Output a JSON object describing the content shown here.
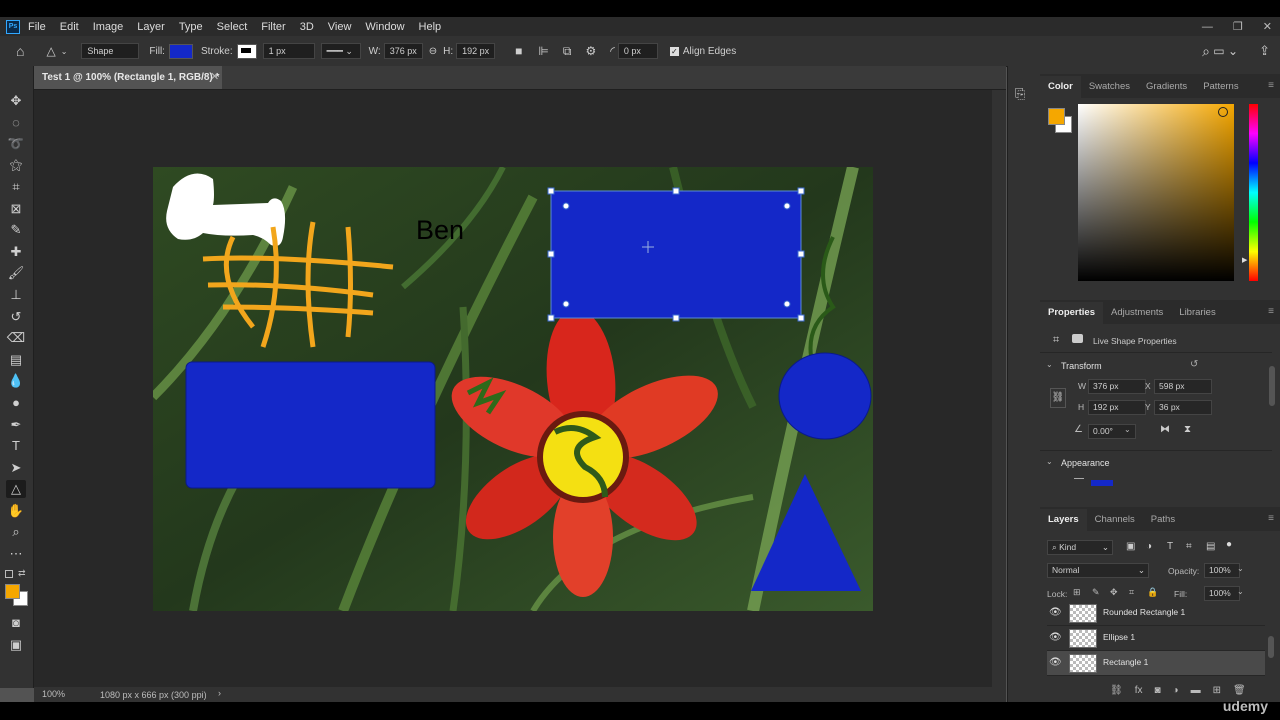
{
  "menu": {
    "items": [
      "File",
      "Edit",
      "Image",
      "Layer",
      "Type",
      "Select",
      "Filter",
      "3D",
      "View",
      "Window",
      "Help"
    ]
  },
  "options_bar": {
    "mode": "Shape",
    "fill_label": "Fill:",
    "stroke_label": "Stroke:",
    "stroke_width": "1 px",
    "w_label": "W:",
    "w_value": "376 px",
    "h_label": "H:",
    "h_value": "192 px",
    "radius_value": "0 px",
    "align_edges_label": "Align Edges",
    "align_edges_checked": true,
    "fill_color": "#1428c8"
  },
  "document": {
    "tab_title": "Test 1 @ 100% (Rectangle 1, RGB/8) *",
    "canvas_text": "Ben",
    "zoom": "100%",
    "doc_info": "1080 px x 666 px (300 ppi)"
  },
  "color_panel": {
    "tabs": [
      "Color",
      "Swatches",
      "Gradients",
      "Patterns"
    ],
    "foreground": "#f5a700",
    "background": "#ffffff"
  },
  "properties_panel": {
    "tabs": [
      "Properties",
      "Adjustments",
      "Libraries"
    ],
    "live_shape_label": "Live Shape Properties",
    "transform_label": "Transform",
    "w_label": "W",
    "w_value": "376 px",
    "h_label": "H",
    "h_value": "192 px",
    "x_label": "X",
    "x_value": "598 px",
    "y_label": "Y",
    "y_value": "36 px",
    "angle_value": "0.00°",
    "appearance_label": "Appearance"
  },
  "layers_panel": {
    "tabs": [
      "Layers",
      "Channels",
      "Paths"
    ],
    "filter_kind": "Kind",
    "blend_mode": "Normal",
    "opacity_label": "Opacity:",
    "opacity_value": "100%",
    "lock_label": "Lock:",
    "fill_label": "Fill:",
    "fill_value": "100%",
    "layers": [
      {
        "name": "Rounded Rectangle 1",
        "visible": true,
        "selected": false
      },
      {
        "name": "Ellipse 1",
        "visible": true,
        "selected": false
      },
      {
        "name": "Rectangle 1",
        "visible": true,
        "selected": true
      }
    ]
  },
  "watermark": "udemy",
  "colors": {
    "shape_blue": "#1428c8",
    "accent_orange": "#f5a700"
  }
}
